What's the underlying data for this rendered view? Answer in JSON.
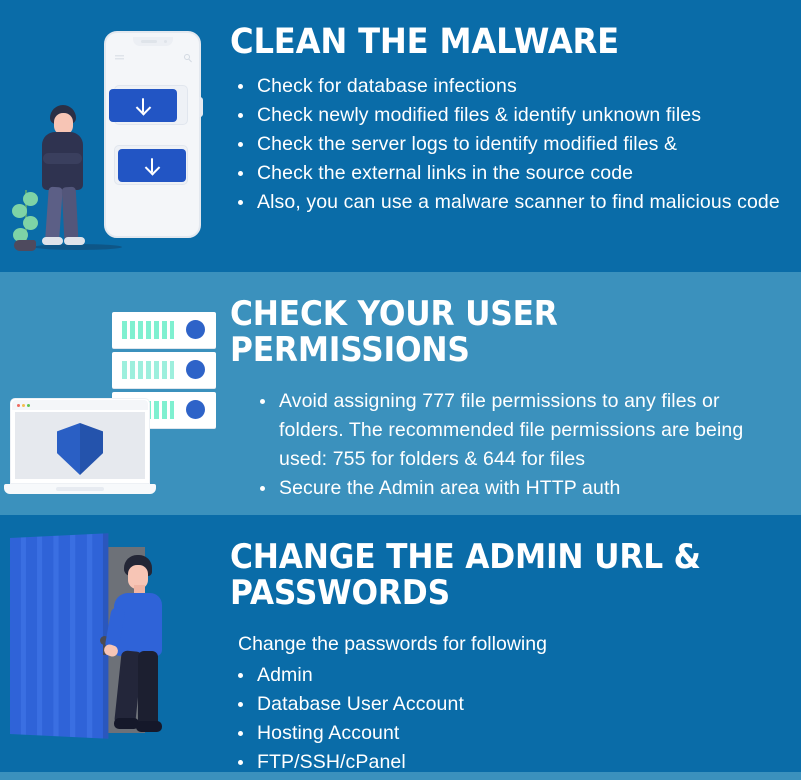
{
  "theme": {
    "band_dark": "#0a6ca8",
    "band_light": "#3b91bd",
    "text": "#ffffff",
    "accent_button": "#2255c4",
    "shield": "#2a5fc4",
    "server_bars": "#7ff0d0",
    "door": "#2f63d8"
  },
  "sections": [
    {
      "heading": "CLEAN THE MALWARE",
      "bullets": [
        "Check for database infections",
        "Check newly modified files & identify unknown files",
        "Check the server logs to identify modified files &",
        "Check the external links in the source code",
        "Also, you can use a malware scanner to find malicious code"
      ],
      "illustration": {
        "name": "phone-download-person",
        "phone": {
          "menu_icon": "hamburger-icon",
          "search_icon": "search-icon",
          "buttons": [
            {
              "icon": "download-arrow-icon"
            },
            {
              "icon": "download-arrow-icon"
            }
          ]
        },
        "person": "standing-person-arms-crossed",
        "plant": "potted-plant"
      }
    },
    {
      "heading": "CHECK YOUR USER\nPERMISSIONS",
      "bullets": [
        "Avoid assigning 777 file permissions to any files or folders. The recommended file permissions are being used: 755 for folders & 644 for files",
        "Secure the Admin area with HTTP auth"
      ],
      "illustration": {
        "name": "laptop-shield-server-rack",
        "laptop_icon": "laptop-icon",
        "shield_icon": "shield-icon",
        "server_icon": "server-rack-icon",
        "server_shelves": 3
      }
    },
    {
      "heading": "CHANGE THE ADMIN URL &\nPASSWORDS",
      "intro": "Change the passwords for following",
      "bullets": [
        "Admin",
        "Database User Account",
        "Hosting Account",
        "FTP/SSH/cPanel"
      ],
      "illustration": {
        "name": "person-opening-door",
        "door_icon": "door-icon",
        "knob_icon": "doorknob-icon",
        "person": "person-opening-door"
      }
    }
  ]
}
